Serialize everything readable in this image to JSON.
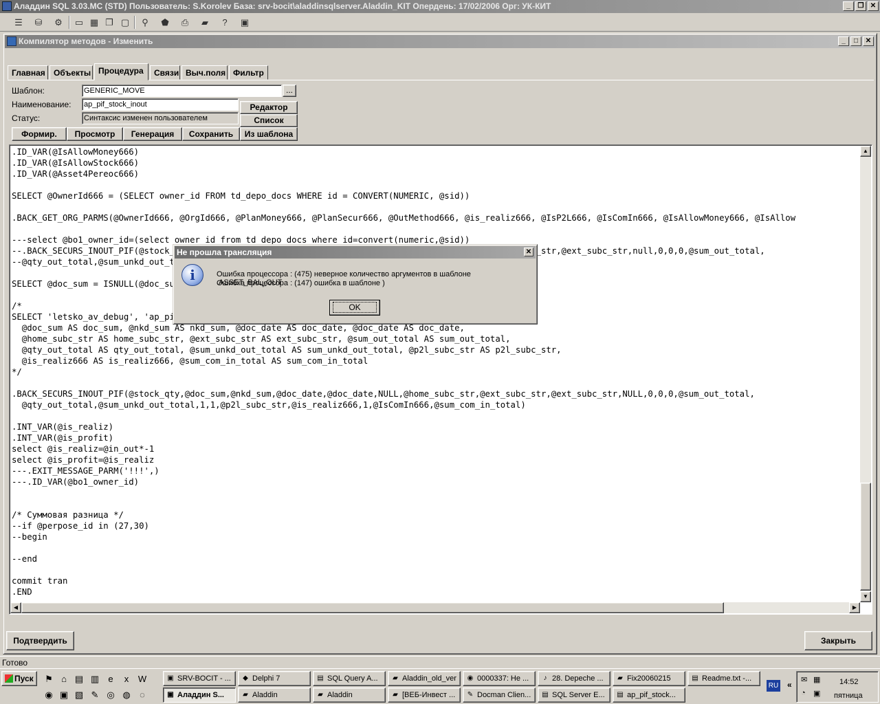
{
  "app": {
    "title": "Аладдин SQL 3.03.MC (STD)  Пользователь: S.Korolev База: srv-bocit\\aladdinsqlserver.Aladdin_KIT Опердень: 17/02/2006 Орг: УК-КИТ"
  },
  "toolbar": {
    "icons": [
      "list",
      "cylinder",
      "tree",
      "window",
      "tile",
      "cascade",
      "arrange",
      "binoculars",
      "stop",
      "print",
      "folder",
      "help",
      "exit"
    ]
  },
  "child": {
    "title": "Компилятор методов - Изменить"
  },
  "tabs": [
    {
      "label": "Главная"
    },
    {
      "label": "Объекты"
    },
    {
      "label": "Процедура"
    },
    {
      "label": "Связи"
    },
    {
      "label": "Выч.поля"
    },
    {
      "label": "Фильтр"
    }
  ],
  "form": {
    "template_label": "Шаблон:",
    "template_value": "GENERIC_MOVE",
    "browse_label": "...",
    "name_label": "Наименование:",
    "name_value": "ap_pif_stock_inout",
    "status_label": "Статус:",
    "status_value": "Синтаксис изменен пользователем",
    "editor_button": "Редактор",
    "list_button": "Список",
    "actions": [
      {
        "label": "Формир."
      },
      {
        "label": "Просмотр"
      },
      {
        "label": "Генерация"
      },
      {
        "label": "Сохранить"
      },
      {
        "label": "Из шаблона"
      }
    ]
  },
  "editor": {
    "lines": [
      ".ID_VAR(@IsAllowMoney666)",
      ".ID_VAR(@IsAllowStock666)",
      ".ID_VAR(@Asset4Pereoc666)",
      "",
      "SELECT @OwnerId666 = (SELECT owner_id FROM td_depo_docs WHERE id = CONVERT(NUMERIC, @sid))",
      "",
      ".BACK_GET_ORG_PARMS(@OwnerId666, @OrgId666, @PlanMoney666, @PlanSecur666, @OutMethod666, @is_realiz666, @IsP2L666, @IsComIn666, @IsAllowMoney666, @IsAllow",
      "",
      "---select @bo1_owner_id=(select owner_id from td_depo_docs where id=convert(numeric,@sid))",
      "--.BACK_SECURS_INOUT_PIF(@stock_qty,@doc_sum,@nkd_sum,@doc_date,@doc_date,NULL,@home_subc_str,@ext_subc_str,@ext_subc_str,null,0,0,0,@sum_out_total,",
      "--@qty_out_total,@sum_unkd_out_total,1,1,@p2l_subc_str)",
      "",
      "SELECT @doc_sum = ISNULL(@doc_sum, 0)",
      "",
      "/*",
      "SELECT 'letsko_av_debug', 'ap_pif_stock_inout' AS proc_name, @stock_qty AS stock_qty,",
      "  @doc_sum AS doc_sum, @nkd_sum AS nkd_sum, @doc_date AS doc_date, @doc_date AS doc_date,",
      "  @home_subc_str AS home_subc_str, @ext_subc_str AS ext_subc_str, @sum_out_total AS sum_out_total,",
      "  @qty_out_total AS qty_out_total, @sum_unkd_out_total AS sum_unkd_out_total, @p2l_subc_str AS p2l_subc_str,",
      "  @is_realiz666 AS is_realiz666, @sum_com_in_total AS sum_com_in_total",
      "*/",
      "",
      ".BACK_SECURS_INOUT_PIF(@stock_qty,@doc_sum,@nkd_sum,@doc_date,@doc_date,NULL,@home_subc_str,@ext_subc_str,@ext_subc_str,NULL,0,0,0,@sum_out_total,",
      "  @qty_out_total,@sum_unkd_out_total,1,1,@p2l_subc_str,@is_realiz666,1,@IsComIn666,@sum_com_in_total)",
      "",
      ".INT_VAR(@is_realiz)",
      ".INT_VAR(@is_profit)",
      "select @is_realiz=@in_out*-1",
      "select @is_profit=@is_realiz",
      "---.EXIT_MESSAGE_PARM('!!!',)",
      "---.ID_VAR(@bo1_owner_id)",
      "",
      "",
      "/* Суммовая разница */",
      "--if @perpose_id in (27,30)",
      "--begin",
      "",
      "--end",
      "",
      "commit tran",
      ".END"
    ]
  },
  "buttons": {
    "confirm": "Подтвердить",
    "close": "Закрыть"
  },
  "status_bar": {
    "text": "Готово"
  },
  "dialog": {
    "title": "Не прошла трансляция",
    "icon": "info-icon",
    "message_1": "Ошибка процессора : (475) неверное количество аргументов в шаблоне .ASSET_BAL_OUT",
    "message_2": "Ошибка процессора : (147) ошибка  в шаблоне )",
    "ok": "OK"
  },
  "taskbar": {
    "start": "Пуск",
    "row1": [
      {
        "label": "SRV-BOCIT - ...",
        "icon": "server-icon"
      },
      {
        "label": "Delphi 7",
        "icon": "delphi-icon"
      },
      {
        "label": "SQL Query A...",
        "icon": "sql-icon"
      },
      {
        "label": "Aladdin_old_ver",
        "icon": "folder-icon"
      },
      {
        "label": "0000337: Не ...",
        "icon": "browser-icon"
      },
      {
        "label": "28. Depeche ...",
        "icon": "music-icon"
      },
      {
        "label": "Fix20060215",
        "icon": "folder-icon"
      },
      {
        "label": "Readme.txt -...",
        "icon": "notepad-icon"
      }
    ],
    "row2": [
      {
        "label": "Аладдин S...",
        "icon": "aladdin-icon"
      },
      {
        "label": "Aladdin",
        "icon": "folder-icon"
      },
      {
        "label": "Aladdin",
        "icon": "folder-icon"
      },
      {
        "label": "[ВЕБ-Инвест ...",
        "icon": "folder-icon"
      },
      {
        "label": "Docman Clien...",
        "icon": "docman-icon"
      },
      {
        "label": "SQL Server E...",
        "icon": "sql-icon"
      },
      {
        "label": "ap_pif_stock...",
        "icon": "notepad-icon"
      }
    ],
    "lang": "RU",
    "time": "14:52",
    "day": "пятница"
  }
}
